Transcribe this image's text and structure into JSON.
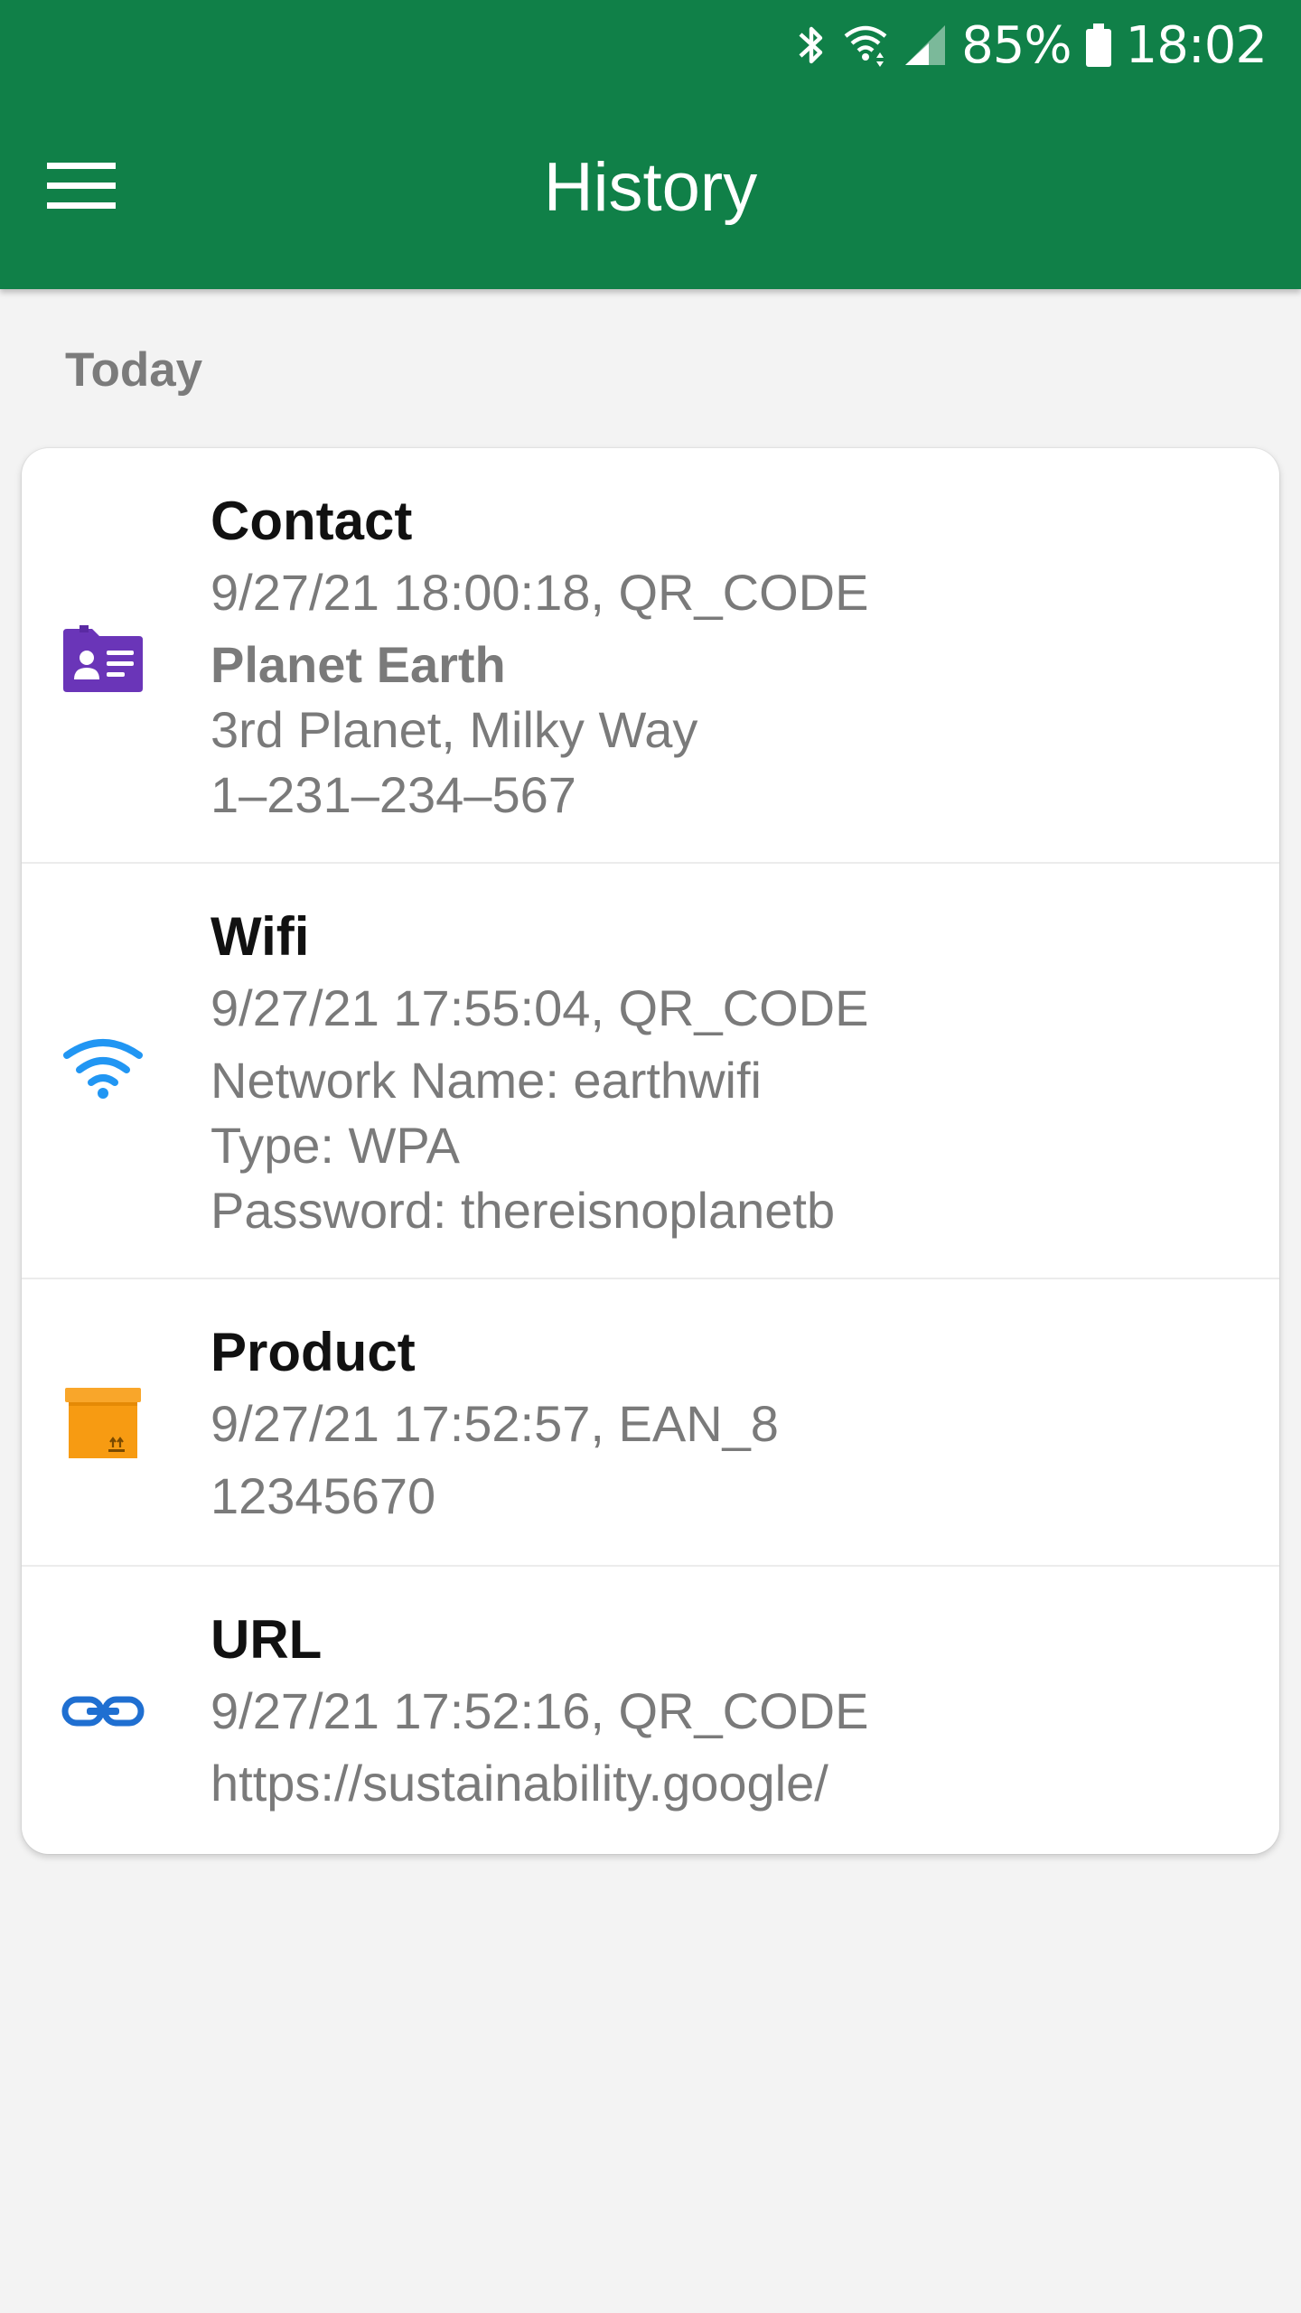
{
  "status_bar": {
    "battery_percent": "85%",
    "time": "18:02",
    "icons": [
      "bluetooth-icon",
      "wifi-icon",
      "signal-icon",
      "battery-icon"
    ]
  },
  "app_bar": {
    "title": "History",
    "menu_icon": "hamburger-menu-icon",
    "color": "#108048"
  },
  "section_header": "Today",
  "history_items": [
    {
      "type": "Contact",
      "icon": "contact-card-icon",
      "icon_color": "#6a35b8",
      "meta": "9/27/21 18:00:18, QR_CODE",
      "name": "Planet Earth",
      "lines": [
        "3rd Planet,  Milky Way",
        "1–231–234–567"
      ]
    },
    {
      "type": "Wifi",
      "icon": "wifi-icon",
      "icon_color": "#2196f3",
      "meta": "9/27/21 17:55:04, QR_CODE",
      "lines": [
        "Network Name: earthwifi",
        "Type: WPA",
        "Password: thereisnoplanetb"
      ]
    },
    {
      "type": "Product",
      "icon": "package-box-icon",
      "icon_color": "#f79b12",
      "meta": "9/27/21 17:52:57, EAN_8",
      "lines": [
        "12345670"
      ]
    },
    {
      "type": "URL",
      "icon": "link-icon",
      "icon_color": "#1f6fd1",
      "meta": "9/27/21 17:52:16, QR_CODE",
      "lines": [
        "https://sustainability.google/"
      ]
    }
  ]
}
